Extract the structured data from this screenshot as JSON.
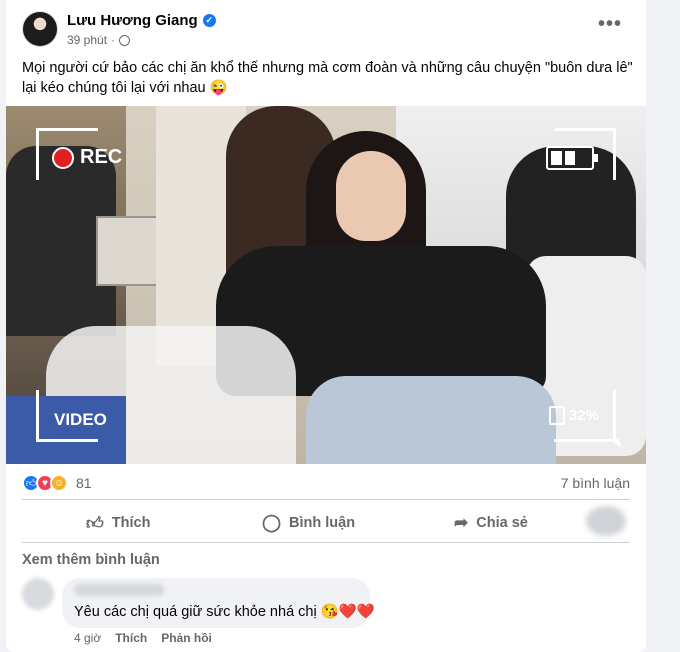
{
  "post": {
    "author": "Lưu Hương Giang",
    "time": "39 phút",
    "separator": "·",
    "more_label": "•••",
    "text_line1": "Mọi người cứ bảo các chị ăn khổ thế nhưng mà cơm đoàn và những câu chuyện \"buôn dưa lê\"",
    "text_line2": "lại kéo chúng tôi lại với nhau 😜"
  },
  "video": {
    "rec_label": "REC",
    "video_label": "VIDEO",
    "battery_percent": "32%",
    "battery_level": 0.66
  },
  "reactions": {
    "count": "81",
    "comments": "7 bình luận",
    "types": [
      "like",
      "love",
      "haha"
    ]
  },
  "actions": {
    "like": "Thích",
    "comment": "Bình luận",
    "share": "Chia sẻ"
  },
  "comments": {
    "view_more": "Xem thêm bình luận",
    "items": [
      {
        "text": "Yêu các chị quá giữ sức khỏe nhá chị 😘❤️❤️",
        "time": "4 giờ",
        "like": "Thích",
        "reply": "Phản hồi"
      }
    ]
  },
  "colors": {
    "accent": "#1877f2",
    "secondary_text": "#65676b",
    "rec_red": "#e02020"
  }
}
